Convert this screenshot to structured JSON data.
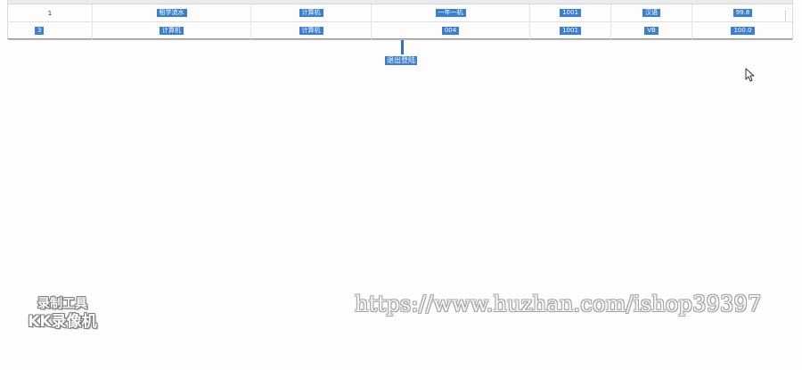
{
  "table": {
    "rows": [
      [
        "1",
        "租学流水",
        "计算机",
        "一年一机",
        "1001",
        "汉语",
        "99.8"
      ],
      [
        "3",
        "计算机",
        "计算机",
        "004",
        "1001",
        "VB",
        "100.0"
      ]
    ]
  },
  "logout": {
    "label": "退出登陆"
  },
  "watermark": {
    "logo_line1": "录制工具",
    "logo_line2": "KK录像机",
    "url": "https://www.huzhan.com/ishop39397"
  },
  "colors": {
    "highlight": "#3a7fd4",
    "highlight_text": "#ffffff",
    "background": "#fcfdfc"
  },
  "icons": {
    "cursor": "mouse-pointer-icon"
  }
}
